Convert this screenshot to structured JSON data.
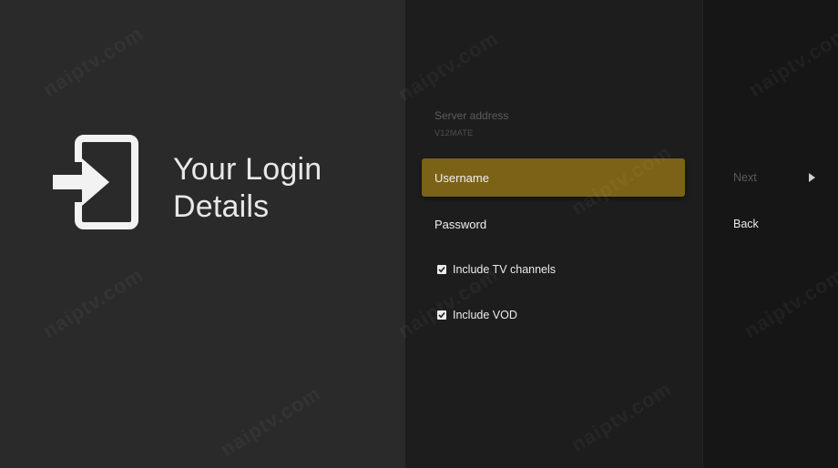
{
  "header": {
    "title_line1": "Your Login",
    "title_line2": "Details"
  },
  "icons": {
    "login": "login-arrow-icon",
    "checkbox": "checkbox-checked-icon",
    "next_arrow": "triangle-right-icon"
  },
  "form": {
    "server_label": "Server address",
    "server_value": "V12MATE",
    "username_label": "Username",
    "password_label": "Password",
    "include_tv_label": "Include TV channels",
    "include_tv_checked": true,
    "include_vod_label": "Include VOD",
    "include_vod_checked": true
  },
  "actions": {
    "next_label": "Next",
    "back_label": "Back"
  },
  "watermark": {
    "text": "naiptv.com"
  },
  "colors": {
    "focus_accent": "#7c6217",
    "left_panel_bg": "#2a2a2a",
    "middle_panel_bg": "#1d1d1d",
    "right_panel_bg": "#161616"
  }
}
